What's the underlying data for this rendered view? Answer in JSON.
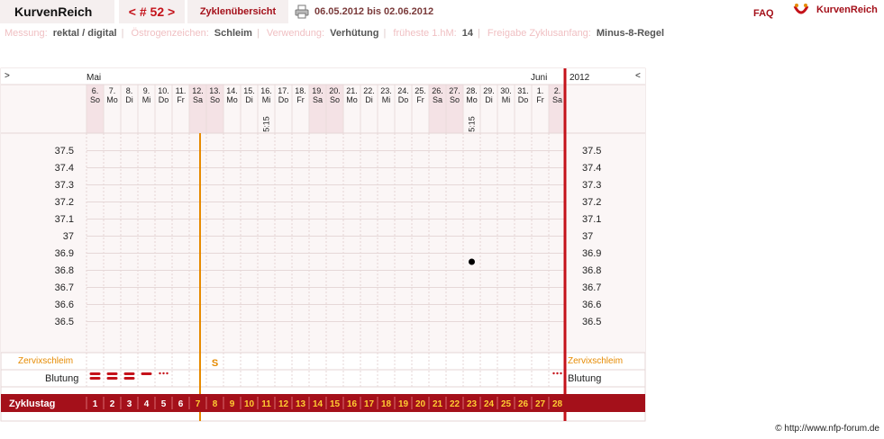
{
  "header": {
    "app_name": "KurvenReich",
    "cycle_nav": "< # 52 >",
    "overview_label": "Zyklenübersicht",
    "date_range": "06.05.2012 bis 02.06.2012",
    "faq": "FAQ",
    "brand": "KurvenReich",
    "icons": {
      "print": "printer-icon",
      "logo": "kurvenreich-logo-icon"
    }
  },
  "info": [
    {
      "label": "Messung:",
      "value": "rektal / digital"
    },
    {
      "label": "Östrogenzeichen:",
      "value": "Schleim"
    },
    {
      "label": "Verwendung:",
      "value": "Verhütung"
    },
    {
      "label": "früheste 1.hM:",
      "value": "14"
    },
    {
      "label": "Freigabe Zyklusanfang:",
      "value": "Minus-8-Regel"
    }
  ],
  "colors": {
    "accent": "#c4121a",
    "band": "#a4101a",
    "weekend": "#f4e2e5",
    "orange": "#e68a00",
    "grid": "#e6d6d6"
  },
  "chart_data": {
    "type": "scatter",
    "nav_left": ">",
    "nav_right": "<",
    "month_start": "Mai",
    "month_end": "Juni",
    "year": "2012",
    "days": [
      {
        "d": "6.",
        "w": "So",
        "we": true
      },
      {
        "d": "7.",
        "w": "Mo"
      },
      {
        "d": "8.",
        "w": "Di"
      },
      {
        "d": "9.",
        "w": "Mi"
      },
      {
        "d": "10.",
        "w": "Do"
      },
      {
        "d": "11.",
        "w": "Fr"
      },
      {
        "d": "12.",
        "w": "Sa",
        "we": true
      },
      {
        "d": "13.",
        "w": "So",
        "we": true
      },
      {
        "d": "14.",
        "w": "Mo"
      },
      {
        "d": "15.",
        "w": "Di"
      },
      {
        "d": "16.",
        "w": "Mi",
        "t": "5:15"
      },
      {
        "d": "17.",
        "w": "Do"
      },
      {
        "d": "18.",
        "w": "Fr"
      },
      {
        "d": "19.",
        "w": "Sa",
        "we": true
      },
      {
        "d": "20.",
        "w": "So",
        "we": true
      },
      {
        "d": "21.",
        "w": "Mo"
      },
      {
        "d": "22.",
        "w": "Di"
      },
      {
        "d": "23.",
        "w": "Mi"
      },
      {
        "d": "24.",
        "w": "Do"
      },
      {
        "d": "25.",
        "w": "Fr"
      },
      {
        "d": "26.",
        "w": "Sa",
        "we": true
      },
      {
        "d": "27.",
        "w": "So",
        "we": true
      },
      {
        "d": "28.",
        "w": "Mo",
        "t": "5:15"
      },
      {
        "d": "29.",
        "w": "Di"
      },
      {
        "d": "30.",
        "w": "Mi"
      },
      {
        "d": "31.",
        "w": "Do"
      },
      {
        "d": "1.",
        "w": "Fr"
      },
      {
        "d": "2.",
        "w": "Sa",
        "we": true
      }
    ],
    "y_ticks": [
      "37.5",
      "37.4",
      "37.3",
      "37.2",
      "37.1",
      "37",
      "36.9",
      "36.8",
      "36.7",
      "36.6",
      "36.5"
    ],
    "ylim": [
      36.5,
      37.5
    ],
    "points": [
      {
        "day": 23,
        "temp": 36.85
      }
    ],
    "cover_line_after_day": 6,
    "mucus_label": "Zervixschleim",
    "mucus": [
      {
        "day": 8,
        "code": "S"
      }
    ],
    "bleeding_label": "Blutung",
    "bleeding": [
      {
        "day": 1,
        "kind": "strong"
      },
      {
        "day": 2,
        "kind": "strong"
      },
      {
        "day": 3,
        "kind": "strong"
      },
      {
        "day": 4,
        "kind": "medium"
      },
      {
        "day": 5,
        "kind": "spotting"
      },
      {
        "day": 28,
        "kind": "spotting"
      }
    ],
    "cycle_label": "Zyklustag",
    "cycle_days": [
      "1",
      "2",
      "3",
      "4",
      "5",
      "6",
      "7",
      "8",
      "9",
      "10",
      "11",
      "12",
      "13",
      "14",
      "15",
      "16",
      "17",
      "18",
      "19",
      "20",
      "21",
      "22",
      "23",
      "24",
      "25",
      "26",
      "27",
      "28"
    ]
  },
  "footer": "© http://www.nfp-forum.de"
}
